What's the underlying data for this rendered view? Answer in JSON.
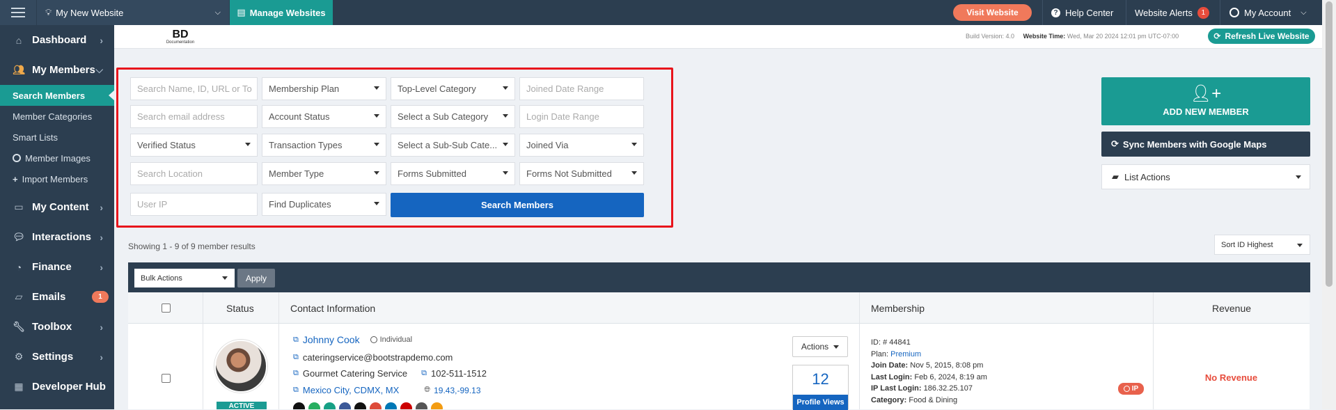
{
  "topbar": {
    "site_name": "My New Website",
    "manage_label": "Manage Websites",
    "visit_label": "Visit Website",
    "help_label": "Help Center",
    "alerts_label": "Website Alerts",
    "alerts_count": "1",
    "account_label": "My Account"
  },
  "sidebar": {
    "items": [
      {
        "label": "Dashboard",
        "icon": "home-icon"
      },
      {
        "label": "My Members",
        "icon": "users-icon"
      },
      {
        "label": "My Content",
        "icon": "folder-icon"
      },
      {
        "label": "Interactions",
        "icon": "comments-icon"
      },
      {
        "label": "Finance",
        "icon": "pie-chart-icon"
      },
      {
        "label": "Emails",
        "icon": "inbox-icon",
        "badge": "1"
      },
      {
        "label": "Toolbox",
        "icon": "wrench-icon"
      },
      {
        "label": "Settings",
        "icon": "gear-icon"
      },
      {
        "label": "Developer Hub",
        "icon": "grid-icon"
      }
    ],
    "sub_items": [
      "Search Members",
      "Member Categories",
      "Smart Lists",
      "Member Images",
      "Import Members"
    ]
  },
  "header": {
    "logo_text": "BD",
    "logo_sub": "Documentation",
    "build_version": "Build Version: 4.0",
    "website_time_label": "Website Time:",
    "website_time_value": "Wed, Mar 20 2024 12:01 pm UTC-07:00",
    "refresh_label": "Refresh Live Website"
  },
  "filters": {
    "search_name_placeholder": "Search Name, ID, URL or To",
    "membership_plan": "Membership Plan",
    "top_category": "Top-Level Category",
    "joined_date_placeholder": "Joined Date Range",
    "email_placeholder": "Search email address",
    "account_status": "Account Status",
    "sub_category": "Select a Sub Category",
    "login_date_placeholder": "Login Date Range",
    "verified_status": "Verified Status",
    "transaction_types": "Transaction Types",
    "sub_sub_category": "Select a Sub-Sub Cate...",
    "joined_via": "Joined Via",
    "location_placeholder": "Search Location",
    "member_type": "Member Type",
    "forms_submitted": "Forms Submitted",
    "forms_not_submitted": "Forms Not Submitted",
    "user_ip_placeholder": "User IP",
    "find_duplicates": "Find Duplicates",
    "search_button": "Search Members"
  },
  "actions": {
    "add_new_member": "ADD NEW MEMBER",
    "sync_google": "Sync Members with Google Maps",
    "list_actions": "List Actions",
    "sort": "Sort ID Highest"
  },
  "results": {
    "showing": "Showing 1 - 9 of 9 member results",
    "bulk_actions": "Bulk Actions",
    "apply": "Apply"
  },
  "table": {
    "headers": [
      "Status",
      "Contact Information",
      "Membership",
      "Revenue"
    ],
    "rows": [
      {
        "name": "Johnny Cook",
        "type": "Individual",
        "email": "cateringservice@bootstrapdemo.com",
        "company": "Gourmet Catering Service",
        "phone": "102-511-1512",
        "location": "Mexico City, CDMX, MX",
        "coords": "19.43,-99.13",
        "status": "ACTIVE",
        "actions_label": "Actions",
        "profile_views_count": "12",
        "profile_views_label": "Profile Views",
        "id_label": "ID:",
        "id_value": "# 44841",
        "plan_label": "Plan:",
        "plan_value": "Premium",
        "join_label": "Join Date:",
        "join_value": "Nov 5, 2015, 8:08 pm",
        "login_label": "Last Login:",
        "login_value": "Feb 6, 2024, 8:19 am",
        "ip_label": "IP Last Login:",
        "ip_value": "186.32.25.107",
        "category_label": "Category:",
        "category_value": "Food & Dining",
        "ip_badge": "IP",
        "revenue": "No Revenue"
      }
    ]
  },
  "colors": {
    "sidebar_bg": "#2c3e50",
    "teal": "#1a9b93",
    "accent_orange": "#f0795b",
    "primary_blue": "#1565c0",
    "red_highlight": "#e8141b"
  }
}
